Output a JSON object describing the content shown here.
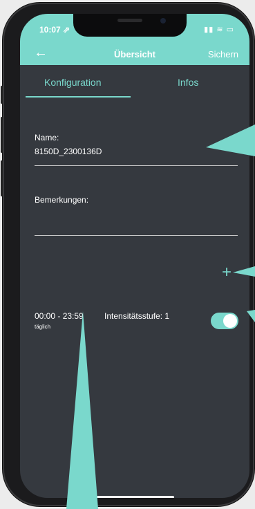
{
  "status_bar": {
    "time": "10:07 ⇗",
    "icons": "▮▮ ≋ ▭"
  },
  "header": {
    "back_icon": "←",
    "title": "Übersicht",
    "save_label": "Sichern"
  },
  "tabs": [
    {
      "label": "Konfiguration",
      "active": true
    },
    {
      "label": "Infos",
      "active": false
    }
  ],
  "form": {
    "name_label": "Name:",
    "name_value": "8150D_2300136D",
    "remarks_label": "Bemerkungen:",
    "remarks_value": ""
  },
  "add_icon": "+",
  "schedule": {
    "time_range": "00:00 - 23:59",
    "frequency": "täglich",
    "intensity": "Intensitätsstufe: 1",
    "enabled": true
  },
  "colors": {
    "accent": "#7ad8cc",
    "background": "#35393f",
    "text": "#ffffff"
  }
}
